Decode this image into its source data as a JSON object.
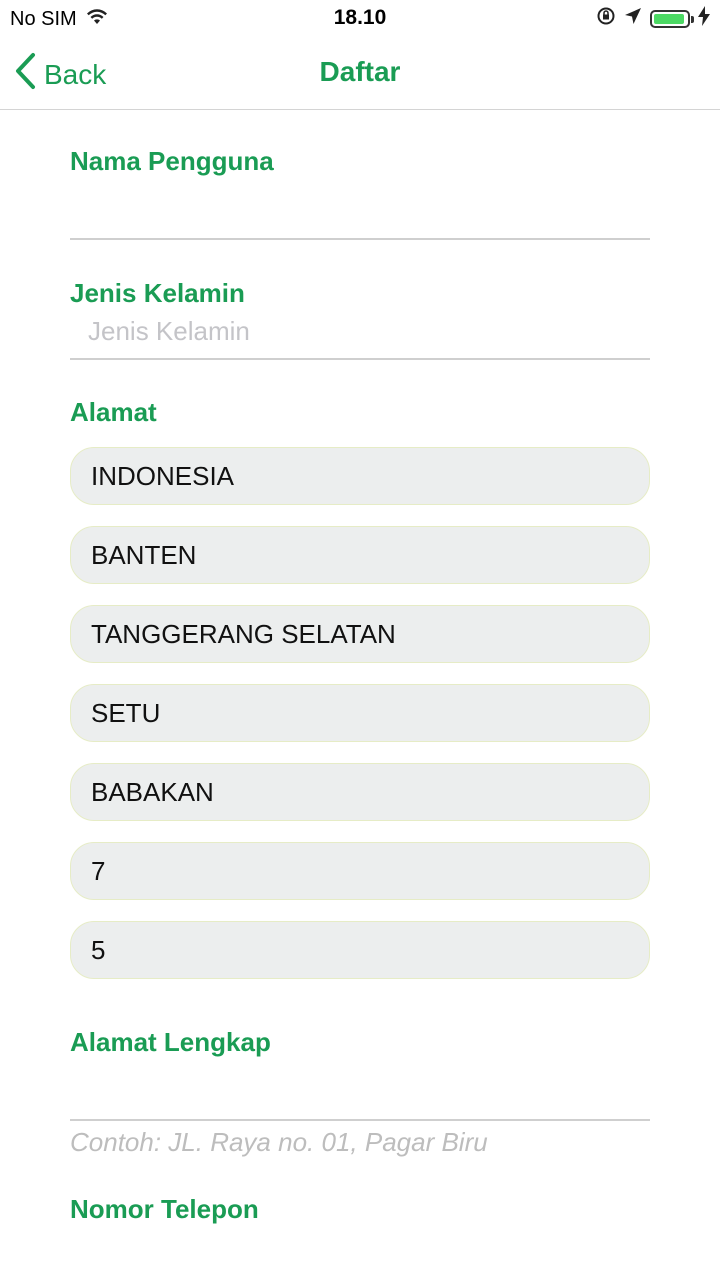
{
  "status_bar": {
    "carrier": "No SIM",
    "time": "18.10"
  },
  "nav": {
    "back_label": "Back",
    "title": "Daftar"
  },
  "form": {
    "username": {
      "label": "Nama Pengguna",
      "value": ""
    },
    "gender": {
      "label": "Jenis Kelamin",
      "placeholder": "Jenis Kelamin"
    },
    "address": {
      "label": "Alamat",
      "options": [
        "INDONESIA",
        "BANTEN",
        "TANGGERANG SELATAN",
        "SETU",
        "BABAKAN",
        "7",
        "5"
      ]
    },
    "full_address": {
      "label": "Alamat Lengkap",
      "value": "",
      "hint": "Contoh: JL. Raya no. 01, Pagar Biru"
    },
    "phone": {
      "label": "Nomor Telepon"
    }
  },
  "colors": {
    "accent": "#1a9c54",
    "pill_bg": "#eceeee",
    "pill_border": "#e6ecc6",
    "battery": "#4cd964"
  },
  "battery_level": 0.95
}
